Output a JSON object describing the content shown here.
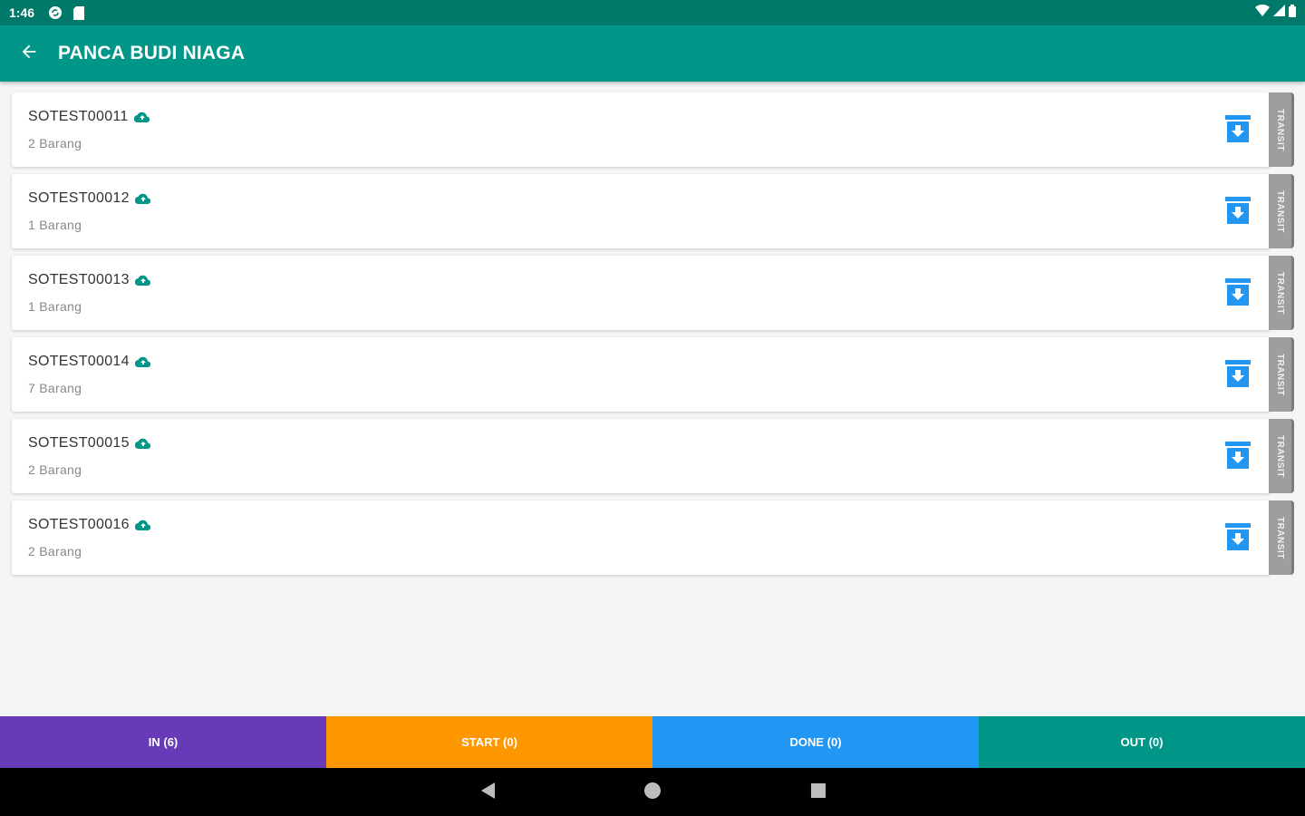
{
  "status_bar": {
    "time": "1:46",
    "icons": [
      "sync-icon",
      "sd-card-icon",
      "wifi-icon",
      "signal-icon",
      "battery-icon"
    ]
  },
  "app_bar": {
    "title": "PANCA BUDI NIAGA",
    "back_icon": "arrow-left-icon"
  },
  "orders": [
    {
      "number": "SOTEST00011",
      "items": "2 Barang",
      "status": "TRANSIT"
    },
    {
      "number": "SOTEST00012",
      "items": "1 Barang",
      "status": "TRANSIT"
    },
    {
      "number": "SOTEST00013",
      "items": "1 Barang",
      "status": "TRANSIT"
    },
    {
      "number": "SOTEST00014",
      "items": "7 Barang",
      "status": "TRANSIT"
    },
    {
      "number": "SOTEST00015",
      "items": "2 Barang",
      "status": "TRANSIT"
    },
    {
      "number": "SOTEST00016",
      "items": "2 Barang",
      "status": "TRANSIT"
    }
  ],
  "bottom_tabs": [
    {
      "label": "IN (6)",
      "color": "#673ab7"
    },
    {
      "label": "START (0)",
      "color": "#ff9800"
    },
    {
      "label": "DONE (0)",
      "color": "#2196f3"
    },
    {
      "label": "OUT (0)",
      "color": "#009688"
    }
  ],
  "colors": {
    "primary": "#009688",
    "primary_dark": "#00796b",
    "accent_blue": "#2196f3",
    "cloud_green": "#009688",
    "transit_gray": "#9e9e9e"
  }
}
